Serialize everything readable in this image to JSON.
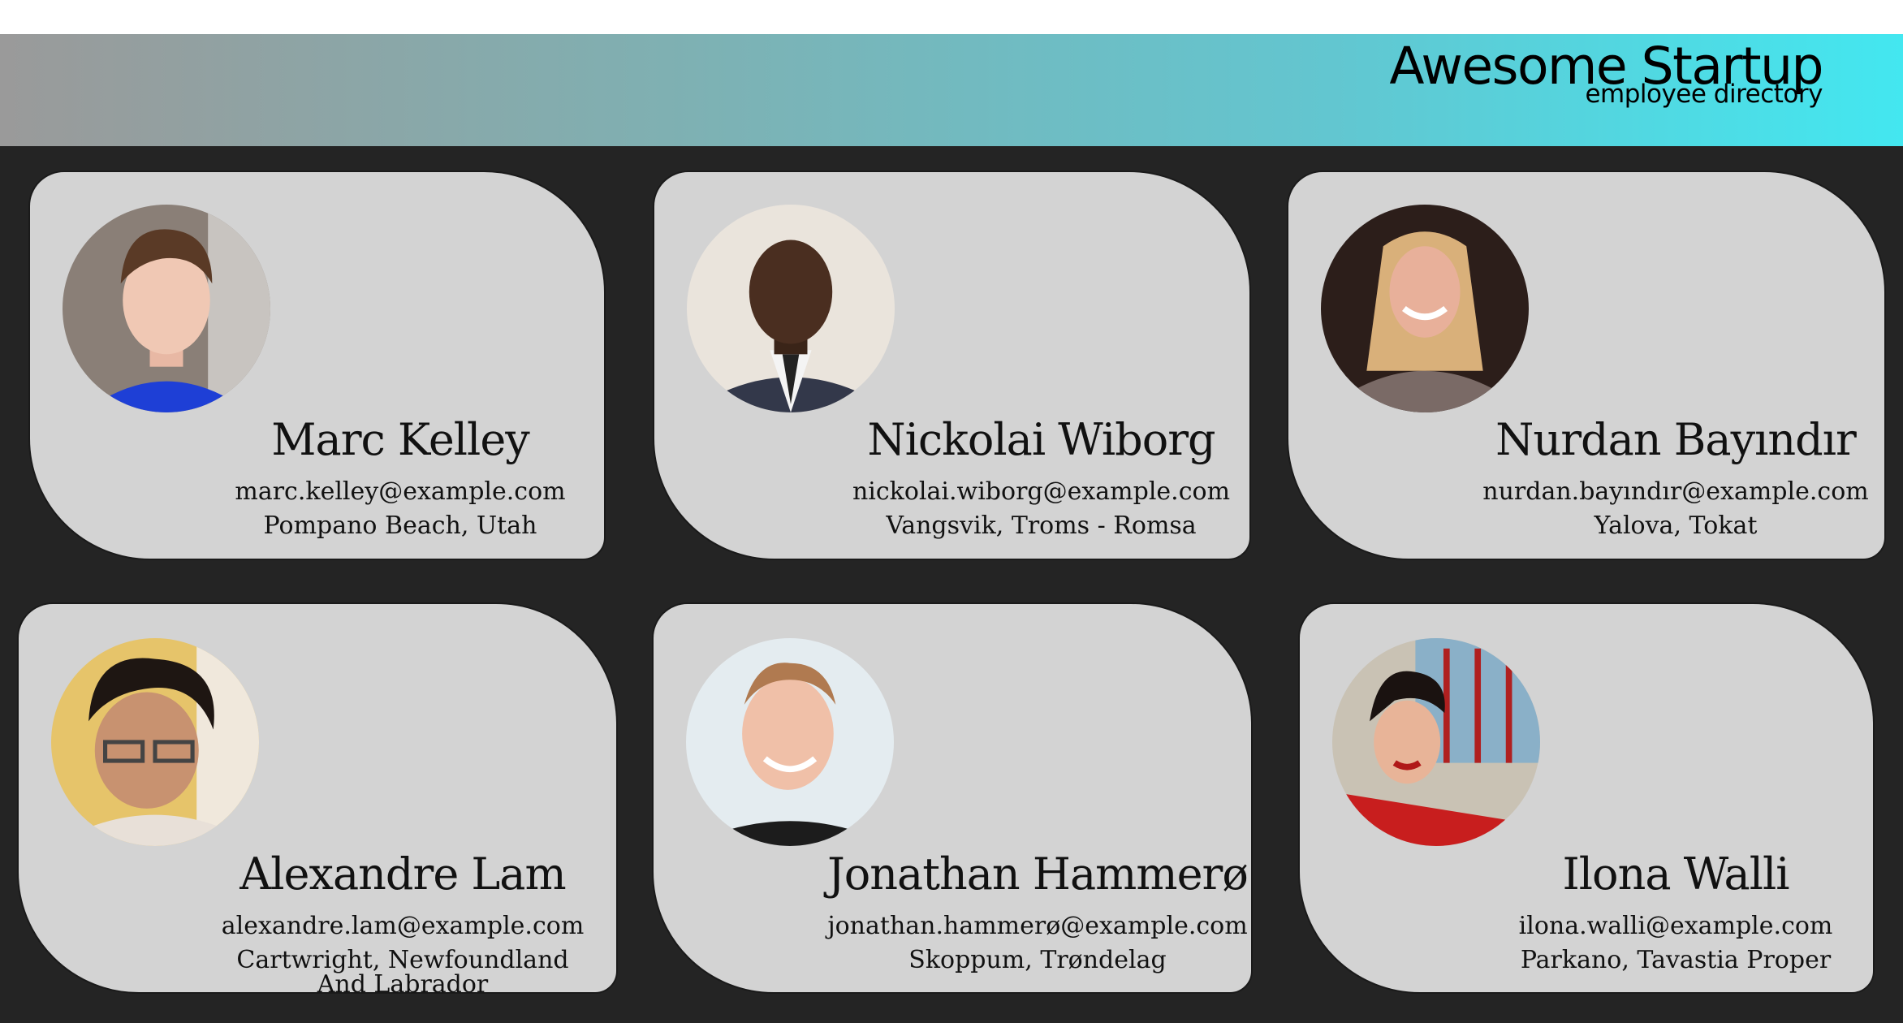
{
  "header": {
    "title": "Awesome Startup",
    "subtitle": "employee directory",
    "gradient_start": "#9a9a9a",
    "gradient_end": "#43e7f0"
  },
  "employees": [
    {
      "name": "Marc Kelley",
      "email": "marc.kelley@example.com",
      "location": "Pompano Beach, Utah"
    },
    {
      "name": "Nickolai Wiborg",
      "email": "nickolai.wiborg@example.com",
      "location": "Vangsvik, Troms - Romsa"
    },
    {
      "name": "Nurdan Bayındır",
      "email": "nurdan.bayındır@example.com",
      "location": "Yalova, Tokat"
    },
    {
      "name": "Alexandre Lam",
      "email": "alexandre.lam@example.com",
      "location": "Cartwright, Newfoundland And Labrador"
    },
    {
      "name": "Jonathan Hammerø",
      "email": "jonathan.hammerø@example.com",
      "location": "Skoppum, Trøndelag"
    },
    {
      "name": "Ilona Walli",
      "email": "ilona.walli@example.com",
      "location": "Parkano, Tavastia Proper"
    }
  ]
}
